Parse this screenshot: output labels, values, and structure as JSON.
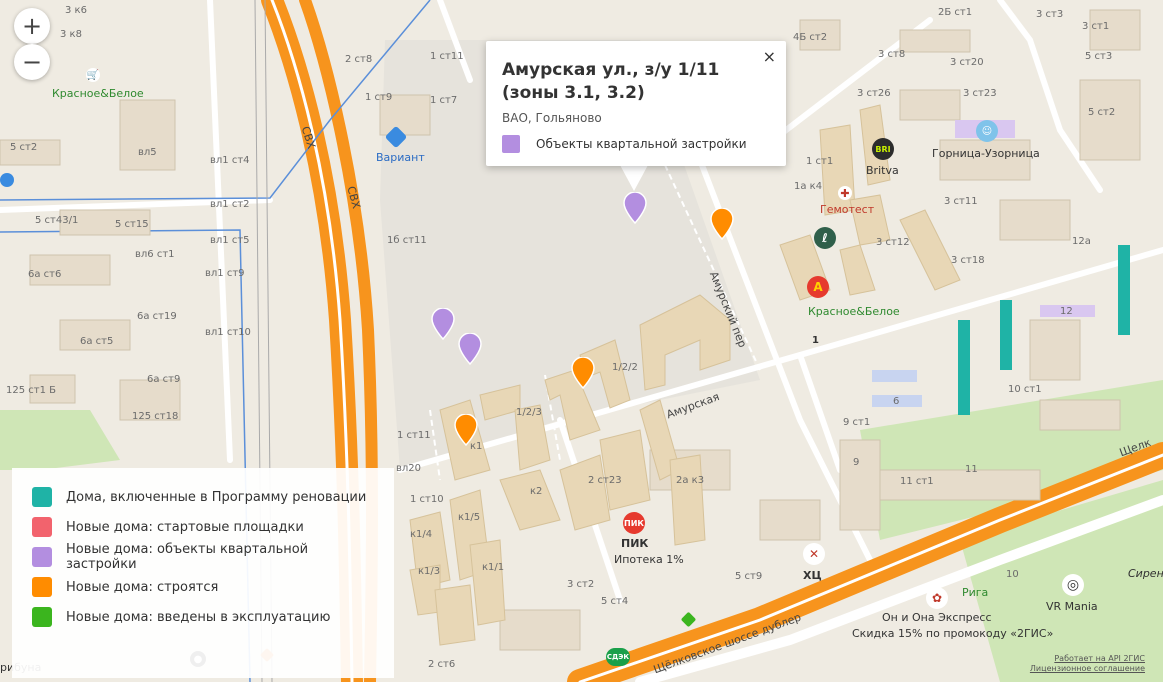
{
  "zoom": {
    "in_label": "+",
    "out_label": "−"
  },
  "popup": {
    "title": "Амурская ул., з/у 1/11 (зоны 3.1, 3.2)",
    "district": "ВАО, Гольяново",
    "category": "Объекты квартальной застройки",
    "category_color": "#b38ee0",
    "close_label": "×"
  },
  "legend": {
    "items": [
      {
        "label": "Дома, включенные в Программу реновации",
        "color": "#1fb3a6"
      },
      {
        "label": "Новые дома: стартовые площадки",
        "color": "#f2636d"
      },
      {
        "label": "Новые дома: объекты квартальной застройки",
        "color": "#b38ee0"
      },
      {
        "label": "Новые дома: строятся",
        "color": "#ff8c00"
      },
      {
        "label": "Новые дома: введены в эксплуатацию",
        "color": "#3bb51e"
      }
    ]
  },
  "map": {
    "pois": {
      "variant": "Вариант",
      "krasnoe_left": "Красное&Белое",
      "krasnoe_right": "Красное&Белое",
      "britva": "Britva",
      "gornitsa": "Горница-Узорница",
      "gemotest": "Гемотест",
      "pik": "ПИК",
      "pik_promo": "Ипотека 1%",
      "hc": "ХЦ",
      "riga": "Рига",
      "on_ona": "Он и Она Экспресс",
      "on_ona_promo": "Скидка 15% по промокоду «2ГИС»",
      "vr_mania": "VR Mania",
      "sireneviy": "Сирене",
      "tribuna": "рибуна"
    },
    "roads": {
      "svh_1": "СВХ",
      "svh_2": "СВХ",
      "amurskaya": "Амурская",
      "amursky_per": "Амурский пер",
      "schelk_dubler": "Щёлковское шоссе дублер",
      "schelk": "Щелк"
    },
    "buildings": [
      "3 к8",
      "3 к6",
      "2 ст8",
      "1 ст11",
      "1 ст9",
      "1 ст7",
      "5 ст2",
      "вл5",
      "вл1 ст4",
      "вл1 ст2",
      "5 ст43/1",
      "5 ст15",
      "вл6 ст1",
      "вл1 ст5",
      "6а ст6",
      "вл1 ст9",
      "6а ст19",
      "6а ст5",
      "вл1 ст10",
      "125 ст1 Б",
      "6а ст9",
      "125 ст18",
      "1б ст11",
      "1 ст11",
      "вл20",
      "1 ст10",
      "1/2/3",
      "1/2/2",
      "к1",
      "к2",
      "2 ст23",
      "2а к3",
      "к1/5",
      "к1/4",
      "к1/3",
      "к1/1",
      "3 ст2",
      "5 ст9",
      "5 ст4",
      "2 ст6",
      "4Б ст2",
      "3 ст8",
      "3 ст20",
      "2Б ст1",
      "3 ст1",
      "5 ст3",
      "3 ст26",
      "3 ст23",
      "5 ст2",
      "1 ст1",
      "1а к4",
      "3 ст11",
      "3 ст12",
      "3 ст18",
      "12а",
      "12",
      "6",
      "10 ст1",
      "9 ст1",
      "9",
      "11",
      "11 ст1",
      "10",
      "3 ст3",
      "1"
    ],
    "credits": {
      "api": "Работает на API 2ГИС",
      "license": "Лицензионное соглашение"
    },
    "colors": {
      "background": "#efebe2",
      "park": "#cfe6b6",
      "highway": "#f7941d",
      "building": "#e8d7b6",
      "building3d": "#ddc9a3",
      "renovation": "#1fb3a6",
      "water_line": "#5b8fd9"
    }
  }
}
